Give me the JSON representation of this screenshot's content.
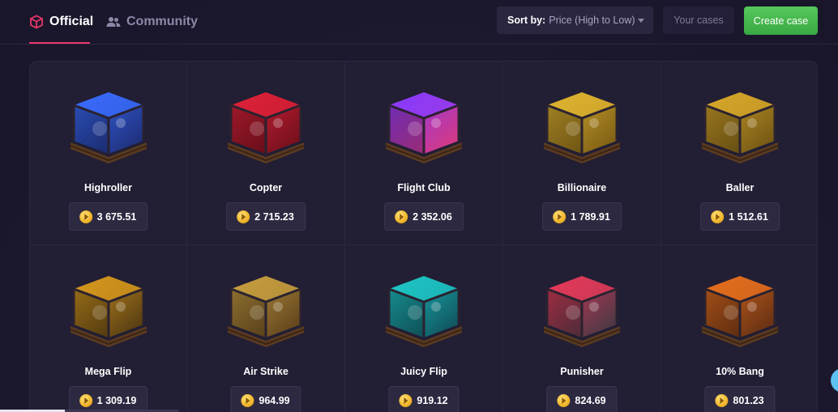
{
  "tabs": [
    {
      "label": "Official",
      "icon": "cube-icon",
      "active": true
    },
    {
      "label": "Community",
      "icon": "users-icon",
      "active": false
    }
  ],
  "sort": {
    "label": "Sort by:",
    "value": "Price (High to Low)"
  },
  "buttons": {
    "your_cases": "Your cases",
    "create_case": "Create case"
  },
  "colors": {
    "accent": "#e8376a",
    "create": "#4cbb50",
    "coin": "#f0b429"
  },
  "cases": [
    {
      "name": "Highroller",
      "price": "3 675.51",
      "theme": "#3a6cff",
      "theme2": "#1b2a6e"
    },
    {
      "name": "Copter",
      "price": "2 715.23",
      "theme": "#e0223a",
      "theme2": "#6e0d18"
    },
    {
      "name": "Flight Club",
      "price": "2 352.06",
      "theme": "#8a3bff",
      "theme2": "#e83a7a"
    },
    {
      "name": "Billionaire",
      "price": "1 789.91",
      "theme": "#e0b530",
      "theme2": "#7a5a10"
    },
    {
      "name": "Baller",
      "price": "1 512.61",
      "theme": "#d8a82a",
      "theme2": "#6e5210"
    },
    {
      "name": "Mega Flip",
      "price": "1 309.19",
      "theme": "#d89a1e",
      "theme2": "#4a3410"
    },
    {
      "name": "Air Strike",
      "price": "964.99",
      "theme": "#c8a040",
      "theme2": "#5a3c18"
    },
    {
      "name": "Juicy Flip",
      "price": "919.12",
      "theme": "#1fc8c8",
      "theme2": "#0d4a55"
    },
    {
      "name": "Punisher",
      "price": "824.69",
      "theme": "#e83a5a",
      "theme2": "#3a3a44"
    },
    {
      "name": "10% Bang",
      "price": "801.23",
      "theme": "#e8701e",
      "theme2": "#5a2a10"
    }
  ]
}
